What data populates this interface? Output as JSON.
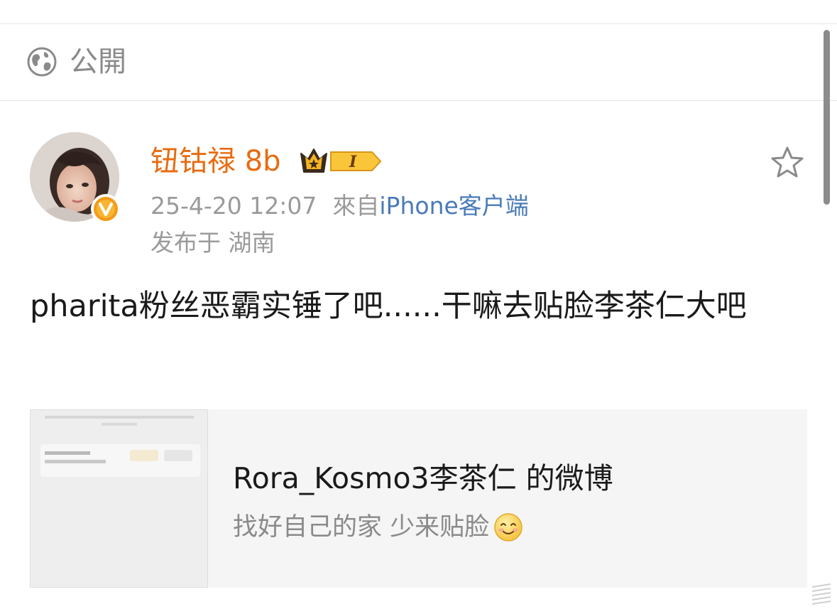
{
  "visibility": {
    "icon": "globe-icon",
    "label": "公開"
  },
  "post": {
    "author": {
      "name": "钮钴禄 8b",
      "name_color": "#e86b10",
      "avatar_icon": "avatar-photo",
      "verify_badge_icon": "orange-v-badge",
      "member_badge_icon": "crown-level-badge",
      "member_badge_text": "I"
    },
    "favorite_icon": "star-outline-icon",
    "time": "25-4-20 12:07",
    "source_prefix": "來自",
    "source_client": "iPhone客户端",
    "location": "发布于 湖南",
    "text": "pharita粉丝恶霸实锤了吧......干嘛去贴脸李茶仁大吧",
    "link_card": {
      "title": "Rora_Kosmo3李茶仁 的微博",
      "description": "找好自己的家 少来贴脸",
      "emoji": "smile-emoji-icon"
    }
  },
  "colors": {
    "accent_orange": "#e86b10",
    "link_blue": "#4a7ab8",
    "muted_text": "#9a9a9a",
    "card_bg": "#f5f5f5"
  }
}
